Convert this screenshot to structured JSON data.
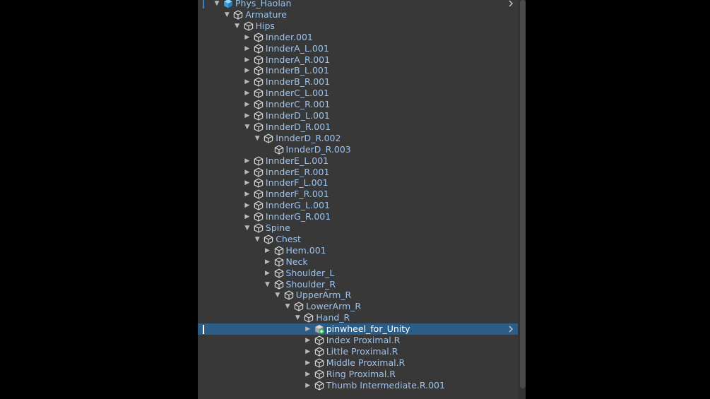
{
  "hierarchy": {
    "items": [
      {
        "label": "Phys_Haolan",
        "level": 0,
        "expanded": true,
        "prefab": true,
        "marker": true,
        "chevron": true
      },
      {
        "label": "Armature",
        "level": 1,
        "expanded": true
      },
      {
        "label": "Hips",
        "level": 2,
        "expanded": true
      },
      {
        "label": "Innder.001",
        "level": 3,
        "expanded": false
      },
      {
        "label": "InnderA_L.001",
        "level": 3,
        "expanded": false
      },
      {
        "label": "InnderA_R.001",
        "level": 3,
        "expanded": false
      },
      {
        "label": "InnderB_L.001",
        "level": 3,
        "expanded": false
      },
      {
        "label": "InnderB_R.001",
        "level": 3,
        "expanded": false
      },
      {
        "label": "InnderC_L.001",
        "level": 3,
        "expanded": false
      },
      {
        "label": "InnderC_R.001",
        "level": 3,
        "expanded": false
      },
      {
        "label": "InnderD_L.001",
        "level": 3,
        "expanded": false
      },
      {
        "label": "InnderD_R.001",
        "level": 3,
        "expanded": true
      },
      {
        "label": "InnderD_R.002",
        "level": 4,
        "expanded": true
      },
      {
        "label": "InnderD_R.003",
        "level": 5
      },
      {
        "label": "InnderE_L.001",
        "level": 3,
        "expanded": false
      },
      {
        "label": "InnderE_R.001",
        "level": 3,
        "expanded": false
      },
      {
        "label": "InnderF_L.001",
        "level": 3,
        "expanded": false
      },
      {
        "label": "InnderF_R.001",
        "level": 3,
        "expanded": false
      },
      {
        "label": "InnderG_L.001",
        "level": 3,
        "expanded": false
      },
      {
        "label": "InnderG_R.001",
        "level": 3,
        "expanded": false
      },
      {
        "label": "Spine",
        "level": 3,
        "expanded": true
      },
      {
        "label": "Chest",
        "level": 4,
        "expanded": true
      },
      {
        "label": "Hem.001",
        "level": 5,
        "expanded": false
      },
      {
        "label": "Neck",
        "level": 5,
        "expanded": false
      },
      {
        "label": "Shoulder_L",
        "level": 5,
        "expanded": false
      },
      {
        "label": "Shoulder_R",
        "level": 5,
        "expanded": true
      },
      {
        "label": "UpperArm_R",
        "level": 6,
        "expanded": true
      },
      {
        "label": "LowerArm_R",
        "level": 7,
        "expanded": true
      },
      {
        "label": "Hand_R",
        "level": 8,
        "expanded": true
      },
      {
        "label": "pinwheel_for_Unity",
        "level": 9,
        "expanded": false,
        "selected": true,
        "prefab_added": true,
        "marker": true,
        "chevron": true
      },
      {
        "label": "Index Proximal.R",
        "level": 9,
        "expanded": false
      },
      {
        "label": "Little Proximal.R",
        "level": 9,
        "expanded": false
      },
      {
        "label": "Middle Proximal.R",
        "level": 9,
        "expanded": false
      },
      {
        "label": "Ring Proximal.R",
        "level": 9,
        "expanded": false
      },
      {
        "label": "Thumb Intermediate.R.001",
        "level": 9,
        "expanded": false
      }
    ]
  },
  "colors": {
    "panel_bg": "#383838",
    "label": "#9cc3ee",
    "selected_bg": "#2c5d87",
    "prefab_icon": "#4fb3f2",
    "add_badge": "#3fbf5a"
  }
}
